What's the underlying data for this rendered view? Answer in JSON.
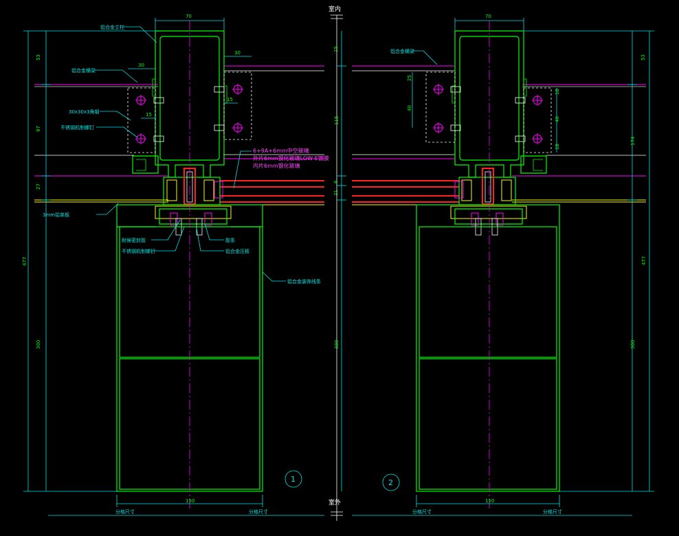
{
  "top_label": "室内",
  "bottom_label": "室外",
  "detail_numbers": [
    "1",
    "2"
  ],
  "dims": {
    "width_70": "70",
    "width_150": "150",
    "width_30": "30",
    "d15": "15",
    "d53": "53",
    "d97": "97",
    "d27": "27",
    "d477": "477",
    "d300": "300",
    "d6": "6",
    "d21": "21",
    "d115": "115",
    "d174": "174",
    "d18": "18",
    "d40": "40",
    "d25": "25"
  },
  "left_labels": {
    "alu_column": "铝合金立柱",
    "alu_beam": "铝合金横梁",
    "angle_steel": "30x30x3角钢",
    "ss_bolt": "不锈钢机制螺钉",
    "panel_3mm": "3mm铝单板",
    "glass_spec_1": "6+9A+6mm中空玻璃",
    "glass_spec_2": "外片6mm钢化玻璃LOW-E镀膜",
    "glass_spec_3": "内片6mm钢化玻璃",
    "sealant": "耐候密封胶",
    "ss_bolt_2": "不锈钢机制螺钉",
    "rubber": "胶条",
    "alu_plate": "铝合金压板",
    "alu_decor": "铝合金装饰线条"
  },
  "right_labels": {
    "alu_beam": "铝合金横梁"
  },
  "bottom_dims": {
    "left_a": "分格尺寸",
    "left_b": "分格尺寸",
    "right_a": "分格尺寸",
    "right_b": "分格尺寸"
  },
  "colors": {
    "background": "#000000",
    "profile": "#00ff00",
    "dimension": "#00e5e5",
    "centerline": "#ff00ff",
    "glass": "#ff2020",
    "seal": "#ffff00"
  }
}
